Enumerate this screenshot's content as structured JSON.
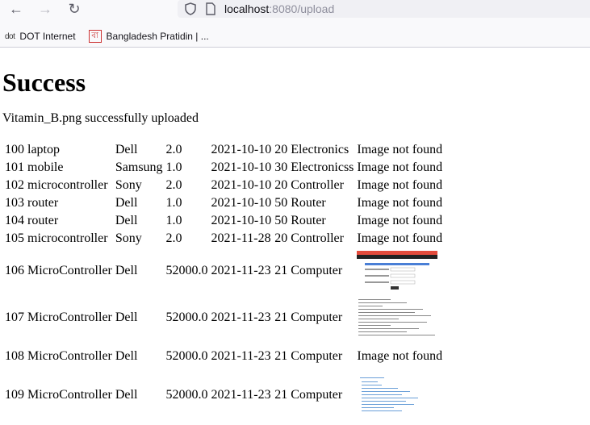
{
  "browser": {
    "url_host": "localhost",
    "url_port": ":8080",
    "url_path": "/upload",
    "bookmarks": [
      {
        "icon": "dot-icon",
        "icon_text": "dot",
        "label": "DOT Internet"
      },
      {
        "icon": "bangladesh-pratidin-icon",
        "icon_text": "বা",
        "label": "Bangladesh Pratidin | ..."
      }
    ]
  },
  "page": {
    "title": "Success",
    "message": "Vitamin_B.png successfully uploaded"
  },
  "table": {
    "rows": [
      {
        "id": "100",
        "name": "laptop",
        "brand": "Dell",
        "price": "2.0",
        "date": "2021-10-10",
        "qty": "20",
        "category": "Electronics",
        "image": "Image not found"
      },
      {
        "id": "101",
        "name": "mobile",
        "brand": "Samsung",
        "price": "1.0",
        "date": "2021-10-10",
        "qty": "30",
        "category": "Electronicss",
        "image": "Image not found"
      },
      {
        "id": "102",
        "name": "microcontroller",
        "brand": "Sony",
        "price": "2.0",
        "date": "2021-10-10",
        "qty": "20",
        "category": "Controller",
        "image": "Image not found"
      },
      {
        "id": "103",
        "name": "router",
        "brand": "Dell",
        "price": "1.0",
        "date": "2021-10-10",
        "qty": "50",
        "category": "Router",
        "image": "Image not found"
      },
      {
        "id": "104",
        "name": "router",
        "brand": "Dell",
        "price": "1.0",
        "date": "2021-10-10",
        "qty": "50",
        "category": "Router",
        "image": "Image not found"
      },
      {
        "id": "105",
        "name": "microcontroller",
        "brand": "Sony",
        "price": "2.0",
        "date": "2021-11-28",
        "qty": "20",
        "category": "Controller",
        "image": "Image not found"
      },
      {
        "id": "106",
        "name": "MicroController",
        "brand": "Dell",
        "price": "52000.0",
        "date": "2021-11-23",
        "qty": "21",
        "category": "Computer",
        "image": ""
      },
      {
        "id": "107",
        "name": "MicroController",
        "brand": "Dell",
        "price": "52000.0",
        "date": "2021-11-23",
        "qty": "21",
        "category": "Computer",
        "image": ""
      },
      {
        "id": "108",
        "name": "MicroController",
        "brand": "Dell",
        "price": "52000.0",
        "date": "2021-11-23",
        "qty": "21",
        "category": "Computer",
        "image": "Image not found"
      },
      {
        "id": "109",
        "name": "MicroController",
        "brand": "Dell",
        "price": "52000.0",
        "date": "2021-11-23",
        "qty": "21",
        "category": "Computer",
        "image": ""
      }
    ]
  }
}
